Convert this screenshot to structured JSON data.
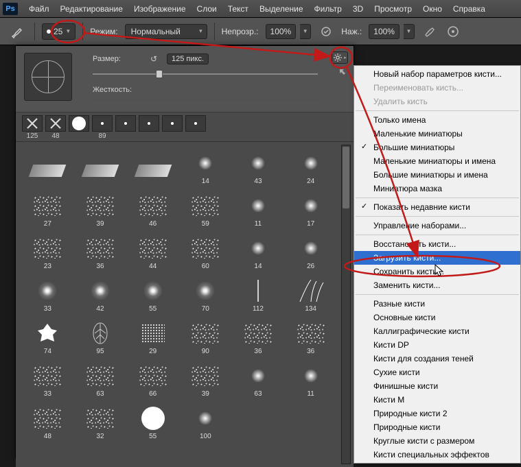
{
  "menubar": {
    "items": [
      "Файл",
      "Редактирование",
      "Изображение",
      "Слои",
      "Текст",
      "Выделение",
      "Фильтр",
      "3D",
      "Просмотр",
      "Окно",
      "Справка"
    ]
  },
  "optbar": {
    "brush_size": "25",
    "mode_label": "Режим:",
    "mode_value": "Нормальный",
    "opacity_label": "Непрозр.:",
    "opacity_value": "100%",
    "flow_label": "Наж.:",
    "flow_value": "100%"
  },
  "panel": {
    "size_label": "Размер:",
    "size_value": "125 пикс.",
    "hardness_label": "Жесткость:",
    "favourites": [
      {
        "label": "125",
        "glyph": "✕"
      },
      {
        "label": "48",
        "glyph": "✕"
      },
      {
        "label": "",
        "glyph": "●"
      },
      {
        "label": "89",
        "glyph": "·"
      },
      {
        "label": "",
        "glyph": "·"
      },
      {
        "label": "",
        "glyph": "·"
      },
      {
        "label": "",
        "glyph": "·"
      },
      {
        "label": "",
        "glyph": "·"
      }
    ],
    "grid": [
      {
        "label": "",
        "t": "grad"
      },
      {
        "label": "",
        "t": "grad"
      },
      {
        "label": "",
        "t": "grad"
      },
      {
        "label": "14",
        "t": "soft"
      },
      {
        "label": "43",
        "t": "soft"
      },
      {
        "label": "24",
        "t": "soft"
      },
      {
        "label": "27",
        "t": "noise"
      },
      {
        "label": "39",
        "t": "noise"
      },
      {
        "label": "46",
        "t": "noise"
      },
      {
        "label": "59",
        "t": "noise"
      },
      {
        "label": "11",
        "t": "soft"
      },
      {
        "label": "17",
        "t": "soft"
      },
      {
        "label": "23",
        "t": "noise"
      },
      {
        "label": "36",
        "t": "noise"
      },
      {
        "label": "44",
        "t": "noise"
      },
      {
        "label": "60",
        "t": "noise"
      },
      {
        "label": "14",
        "t": "soft"
      },
      {
        "label": "26",
        "t": "soft"
      },
      {
        "label": "33",
        "t": "star"
      },
      {
        "label": "42",
        "t": "star"
      },
      {
        "label": "55",
        "t": "star"
      },
      {
        "label": "70",
        "t": "star"
      },
      {
        "label": "112",
        "t": "line"
      },
      {
        "label": "134",
        "t": "grass"
      },
      {
        "label": "74",
        "t": "leaf"
      },
      {
        "label": "95",
        "t": "leaf2"
      },
      {
        "label": "29",
        "t": "dots"
      },
      {
        "label": "90",
        "t": "noise"
      },
      {
        "label": "36",
        "t": "noise"
      },
      {
        "label": "36",
        "t": "noise"
      },
      {
        "label": "33",
        "t": "noise"
      },
      {
        "label": "63",
        "t": "noise"
      },
      {
        "label": "66",
        "t": "noise"
      },
      {
        "label": "39",
        "t": "noise"
      },
      {
        "label": "63",
        "t": "soft"
      },
      {
        "label": "11",
        "t": "soft"
      },
      {
        "label": "48",
        "t": "noise"
      },
      {
        "label": "32",
        "t": "noise"
      },
      {
        "label": "55",
        "t": "round"
      },
      {
        "label": "100",
        "t": "soft"
      },
      {
        "label": "",
        "t": "empty"
      },
      {
        "label": "",
        "t": "empty"
      }
    ]
  },
  "ctx": {
    "groups": [
      [
        {
          "label": "Новый набор параметров кисти..."
        },
        {
          "label": "Переименовать кисть...",
          "disabled": true
        },
        {
          "label": "Удалить кисть",
          "disabled": true
        }
      ],
      [
        {
          "label": "Только имена"
        },
        {
          "label": "Маленькие миниатюры"
        },
        {
          "label": "Большие миниатюры",
          "checked": true
        },
        {
          "label": "Маленькие миниатюры и имена"
        },
        {
          "label": "Большие миниатюры и имена"
        },
        {
          "label": "Миниатюра мазка"
        }
      ],
      [
        {
          "label": "Показать недавние кисти",
          "checked": true
        }
      ],
      [
        {
          "label": "Управление наборами..."
        }
      ],
      [
        {
          "label": "Восстановить кисти..."
        },
        {
          "label": "Загрузить кисти...",
          "highlight": true
        },
        {
          "label": "Сохранить кисти..."
        },
        {
          "label": "Заменить кисти..."
        }
      ],
      [
        {
          "label": "Разные кисти"
        },
        {
          "label": "Основные кисти"
        },
        {
          "label": "Каллиграфические кисти"
        },
        {
          "label": "Кисти DP"
        },
        {
          "label": "Кисти для создания теней"
        },
        {
          "label": "Сухие кисти"
        },
        {
          "label": "Финишные кисти"
        },
        {
          "label": "Кисти M"
        },
        {
          "label": "Природные кисти 2"
        },
        {
          "label": "Природные кисти"
        },
        {
          "label": "Круглые кисти с размером"
        },
        {
          "label": "Кисти специальных эффектов"
        }
      ]
    ]
  },
  "colors": {
    "annotation": "#c21919",
    "highlight": "#2f6fd0"
  }
}
